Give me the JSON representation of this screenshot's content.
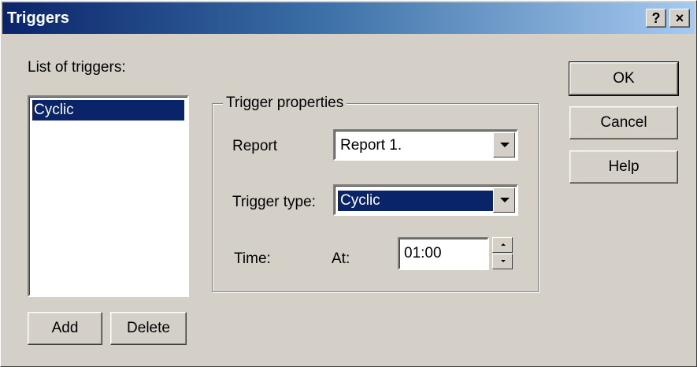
{
  "dialog": {
    "title": "Triggers",
    "help_glyph": "?",
    "close_glyph": "×"
  },
  "triggers": {
    "label": "List of triggers:",
    "items": [
      "Cyclic"
    ],
    "selected": "Cyclic",
    "add_label": "Add",
    "delete_label": "Delete"
  },
  "properties": {
    "group_title": "Trigger properties",
    "report_label": "Report",
    "report_value": "Report 1.",
    "trigger_type_label": "Trigger type:",
    "trigger_type_value": "Cyclic",
    "time_label": "Time:",
    "at_label": "At:",
    "time_value": "01:00"
  },
  "actions": {
    "ok_label": "OK",
    "cancel_label": "Cancel",
    "help_label": "Help"
  },
  "colors": {
    "titlebar_start": "#0a246a",
    "titlebar_end": "#a6caf0",
    "selection": "#0a246a",
    "face": "#d4d0c8"
  }
}
